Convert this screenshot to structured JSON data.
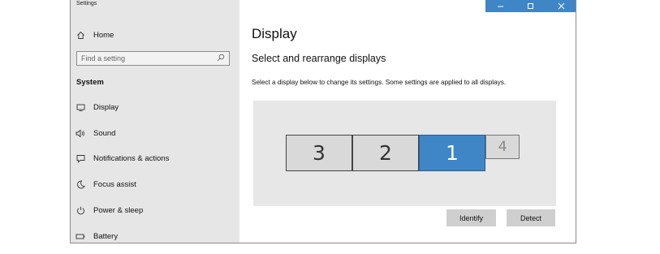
{
  "window": {
    "title": "Settings"
  },
  "sidebar": {
    "home_label": "Home",
    "search_placeholder": "Find a setting",
    "section_label": "System",
    "items": [
      {
        "label": "Display",
        "icon": "monitor-icon"
      },
      {
        "label": "Sound",
        "icon": "speaker-icon"
      },
      {
        "label": "Notifications & actions",
        "icon": "notification-icon"
      },
      {
        "label": "Focus assist",
        "icon": "moon-icon"
      },
      {
        "label": "Power & sleep",
        "icon": "power-icon"
      },
      {
        "label": "Battery",
        "icon": "battery-icon"
      }
    ]
  },
  "main": {
    "title": "Display",
    "subheading": "Select and rearrange displays",
    "description": "Select a display below to change its settings. Some settings are applied to all displays.",
    "monitors": [
      {
        "number": "3",
        "selected": false
      },
      {
        "number": "2",
        "selected": false
      },
      {
        "number": "1",
        "selected": true
      },
      {
        "number": "4",
        "selected": false
      }
    ],
    "identify_label": "Identify",
    "detect_label": "Detect"
  },
  "colors": {
    "accent": "#3f86c7",
    "sidebar_bg": "#e6e6e6",
    "display_area_bg": "#e7e7e7",
    "monitor_bg": "#d9d9d9",
    "button_bg": "#cfcfcf"
  }
}
